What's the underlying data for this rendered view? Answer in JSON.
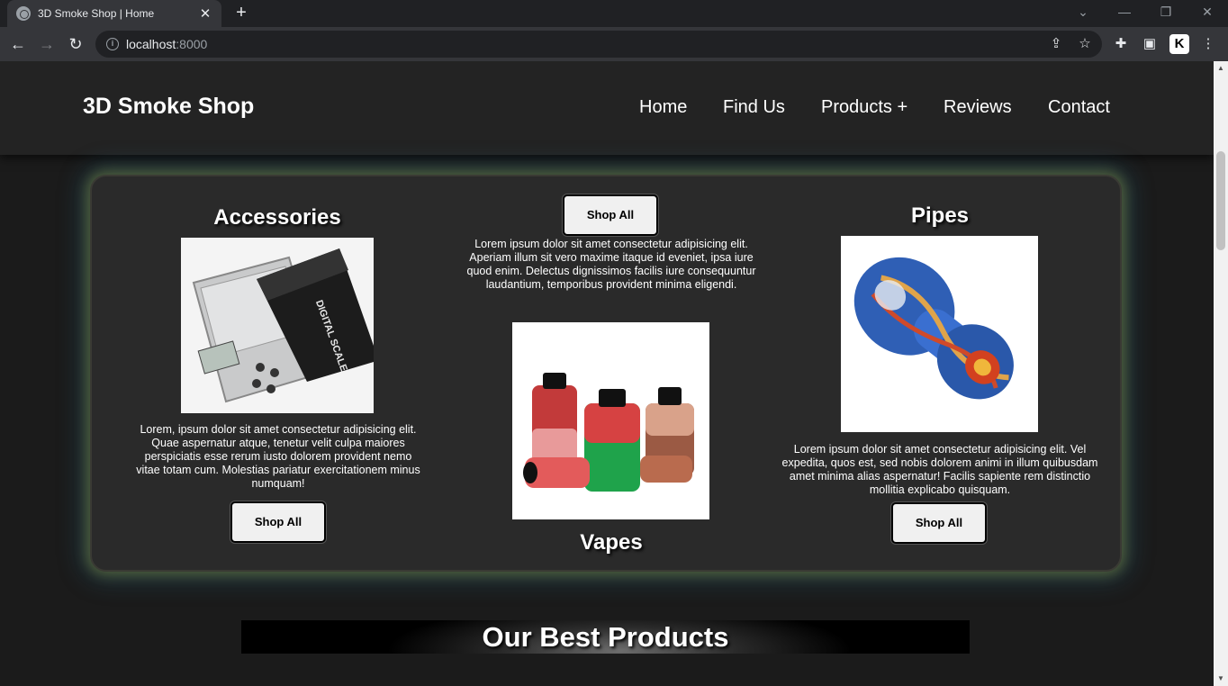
{
  "browser": {
    "tab_title": "3D Smoke Shop | Home",
    "url_host": "localhost",
    "url_port": ":8000"
  },
  "site": {
    "logo": "3D Smoke Shop",
    "nav": [
      "Home",
      "Find Us",
      "Products +",
      "Reviews",
      "Contact"
    ]
  },
  "categories": {
    "accessories": {
      "title": "Accessories",
      "description": "Lorem, ipsum dolor sit amet consectetur adipisicing elit. Quae aspernatur atque, tenetur velit culpa maiores perspiciatis esse rerum iusto dolorem provident nemo vitae totam cum. Molestias pariatur exercitationem minus numquam!",
      "button": "Shop All",
      "image_text": "DIGITAL SCALE"
    },
    "vapes": {
      "title": "Vapes",
      "description": "Lorem ipsum dolor sit amet consectetur adipisicing elit. Aperiam illum sit vero maxime itaque id eveniet, ipsa iure quod enim. Delectus dignissimos facilis iure consequuntur laudantium, temporibus provident minima eligendi.",
      "button": "Shop All"
    },
    "pipes": {
      "title": "Pipes",
      "description": "Lorem ipsum dolor sit amet consectetur adipisicing elit. Vel expedita, quos est, sed nobis dolorem animi in illum quibusdam amet minima alias aspernatur! Facilis sapiente rem distinctio mollitia explicabo quisquam.",
      "button": "Shop All"
    }
  },
  "best_products": {
    "title": "Our Best Products"
  }
}
